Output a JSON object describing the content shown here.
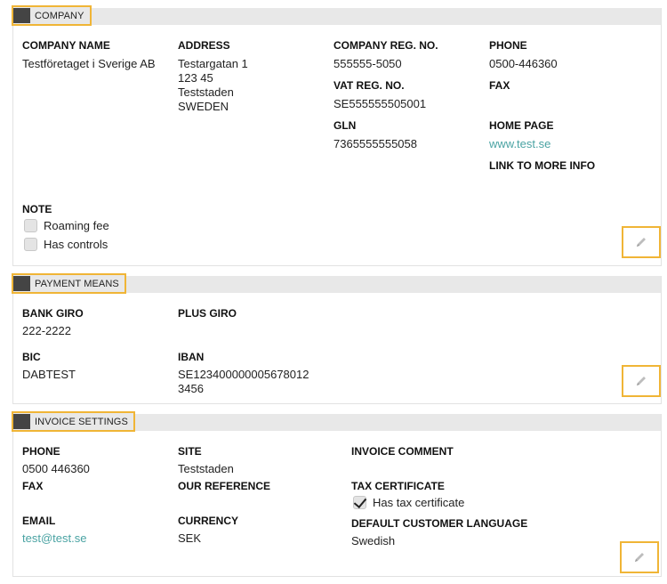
{
  "company": {
    "title": "COMPANY",
    "company_name_label": "COMPANY NAME",
    "company_name": "Testföretaget i Sverige AB",
    "address_label": "ADDRESS",
    "address_line1": "Testargatan 1",
    "address_line2": "123 45",
    "address_line3": "Teststaden",
    "address_line4": "SWEDEN",
    "reg_no_label": "COMPANY REG. NO.",
    "reg_no": "555555-5050",
    "vat_label": "VAT REG. NO.",
    "vat": "SE555555505001",
    "gln_label": "GLN",
    "gln": "7365555555058",
    "phone_label": "PHONE",
    "phone": "0500-446360",
    "fax_label": "FAX",
    "home_page_label": "HOME PAGE",
    "home_page": "www.test.se",
    "more_info_label": "LINK TO MORE INFO",
    "note_label": "NOTE",
    "roaming_fee_label": "Roaming fee",
    "roaming_fee_checked": false,
    "has_controls_label": "Has controls",
    "has_controls_checked": false
  },
  "payment": {
    "title": "PAYMENT MEANS",
    "bank_giro_label": "BANK GIRO",
    "bank_giro": "222-2222",
    "plus_giro_label": "PLUS GIRO",
    "bic_label": "BIC",
    "bic": "DABTEST",
    "iban_label": "IBAN",
    "iban_line1": "SE123400000005678012",
    "iban_line2": "3456"
  },
  "invoice": {
    "title": "INVOICE SETTINGS",
    "phone_label": "PHONE",
    "phone": "0500 446360",
    "site_label": "SITE",
    "site": "Teststaden",
    "comment_label": "INVOICE COMMENT",
    "fax_label": "FAX",
    "our_ref_label": "OUR REFERENCE",
    "tax_cert_label": "TAX CERTIFICATE",
    "has_tax_cert_label": "Has tax certificate",
    "has_tax_cert_checked": true,
    "email_label": "EMAIL",
    "email": "test@test.se",
    "currency_label": "CURRENCY",
    "currency": "SEK",
    "language_label": "DEFAULT CUSTOMER LANGUAGE",
    "language": "Swedish"
  },
  "icons": {
    "section": "section-marker-icon",
    "edit": "pencil-icon"
  },
  "colors": {
    "accent": "#f0b536",
    "link": "#4aa3a3",
    "header_bg": "#e8e8e8",
    "marker": "#444444"
  }
}
